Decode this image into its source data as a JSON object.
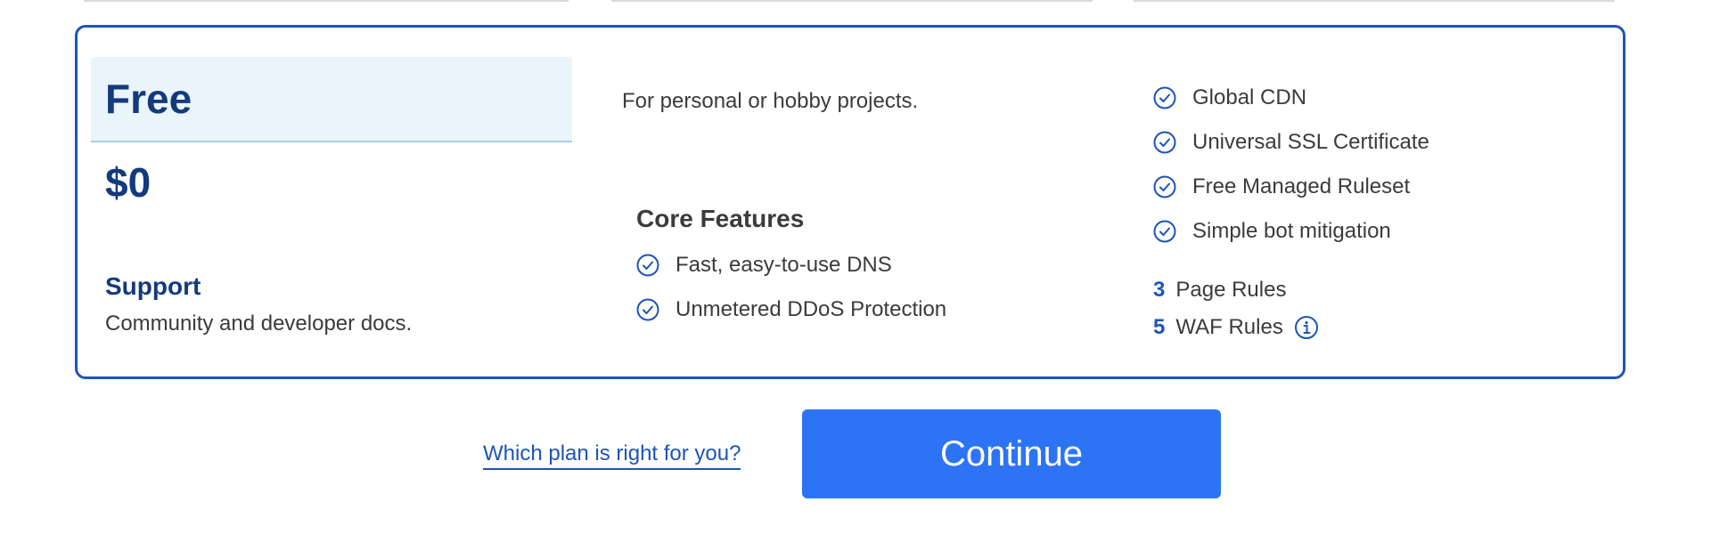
{
  "plan": {
    "name": "Free",
    "price": "$0",
    "support_title": "Support",
    "support_text": "Community and developer docs.",
    "description": "For personal or hobby projects."
  },
  "core_features": {
    "title": "Core Features",
    "items": [
      {
        "label": "Fast, easy-to-use DNS",
        "icon": "check-circle-icon"
      },
      {
        "label": "Unmetered DDoS Protection",
        "icon": "check-circle-icon"
      }
    ]
  },
  "extra_features": [
    {
      "label": "Global CDN",
      "icon": "check-circle-icon"
    },
    {
      "label": "Universal SSL Certificate",
      "icon": "check-circle-icon"
    },
    {
      "label": "Free Managed Ruleset",
      "icon": "check-circle-icon"
    },
    {
      "label": "Simple bot mitigation",
      "icon": "check-circle-icon"
    }
  ],
  "rules": [
    {
      "count": "3",
      "label": "Page Rules"
    },
    {
      "count": "5",
      "label": "WAF Rules",
      "icon": "info-icon"
    }
  ],
  "actions": {
    "help_link": "Which plan is right for you?",
    "continue_label": "Continue"
  },
  "colors": {
    "border": "#1d54b8",
    "header_bg": "#eaf5fb",
    "button_bg": "#2c74f5",
    "title_text": "#133a7c"
  }
}
